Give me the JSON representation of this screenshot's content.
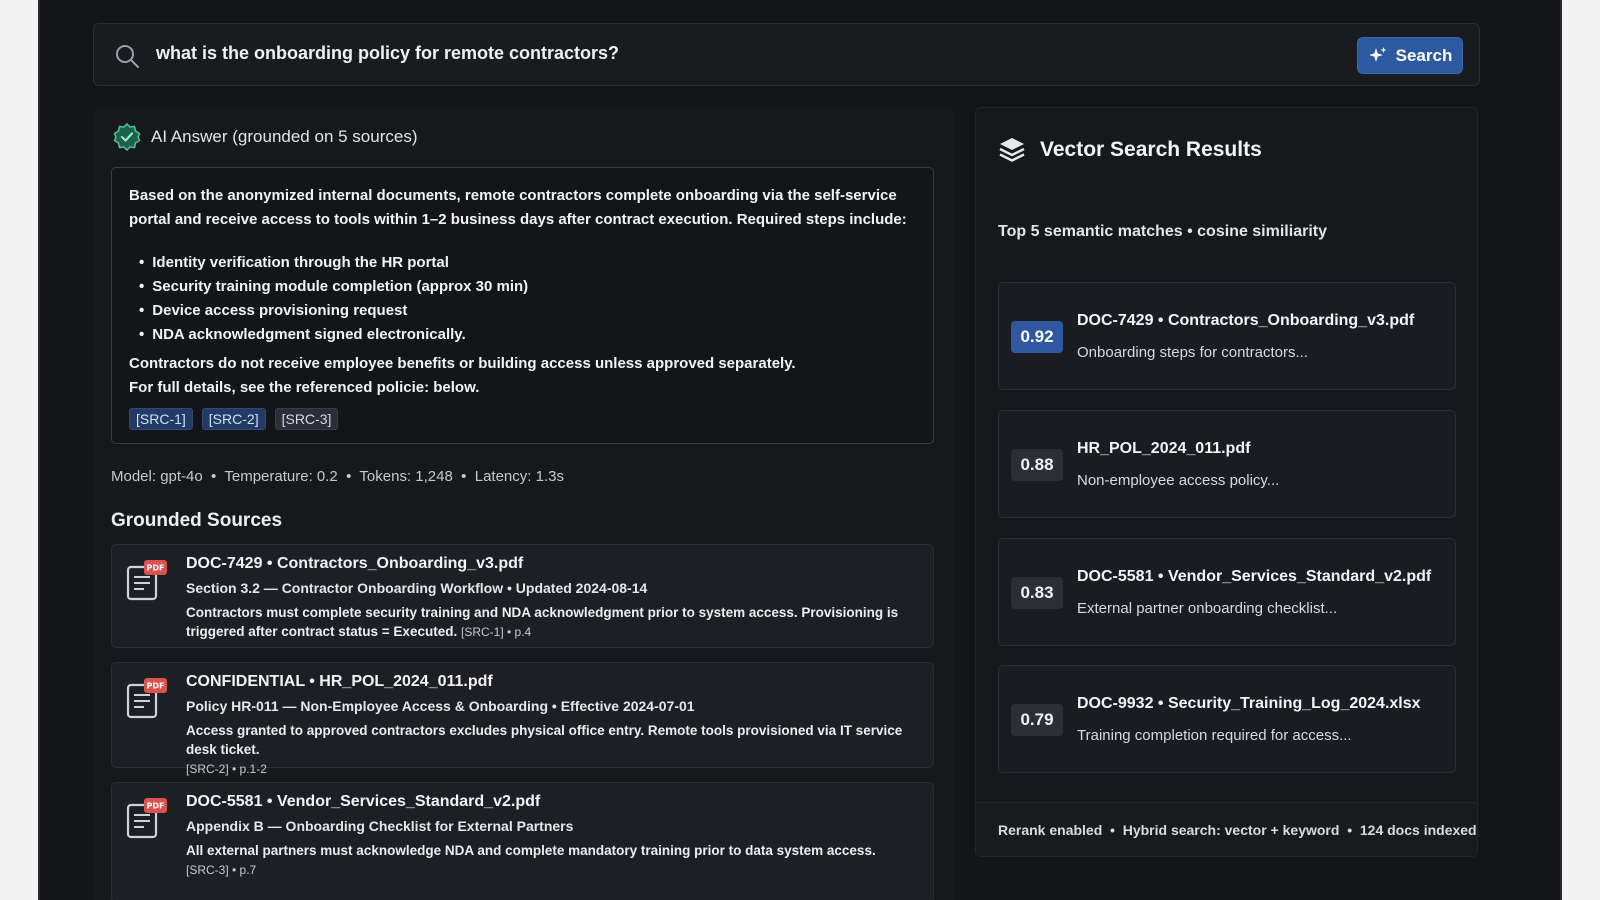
{
  "search": {
    "query": "what is the onboarding policy for remote contractors?",
    "button_label": "Search"
  },
  "answer": {
    "header": "AI Answer (grounded on 5 sources)",
    "intro": "Based on the anonymized internal documents, remote contractors complete onboarding via the self-service portal and receive access to tools within 1–2 business days after contract execution. Required steps include:",
    "steps": [
      "Identity verification through the HR portal",
      "Security training module completion (approx 30 min)",
      "Device access provisioning request",
      "NDA acknowledgment signed electronically."
    ],
    "note1": "Contractors do not receive employee benefits or building access unless approved separately.",
    "note2": "For full details, see the referenced policie: below.",
    "src_tags": [
      "[SRC-1]",
      "[SRC-2]",
      "[SRC-3]"
    ]
  },
  "meta_line": "Model: gpt-4o  •  Temperature: 0.2  •  Tokens: 1,248  •  Latency: 1.3s",
  "grounded_sources": {
    "title": "Grounded Sources",
    "items": [
      {
        "badge": "PDF",
        "title": "DOC-7429 • Contractors_Onboarding_v3.pdf",
        "subtitle": "Section 3.2 — Contractor Onboarding Workflow • Updated 2024-08-14",
        "body": "Contractors must complete security training and NDA acknowledgment prior to system access. Provisioning is triggered after contract status = Executed.",
        "ref": "[SRC-1] • p.4"
      },
      {
        "badge": "PDF",
        "title": "CONFIDENTIAL • HR_POL_2024_011.pdf",
        "subtitle": "Policy HR-011 — Non-Employee Access & Onboarding • Effective 2024-07-01",
        "body": "Access granted to approved contractors excludes physical office entry. Remote tools provisioned via IT service desk ticket.",
        "ref": "[SRC-2] • p.1-2"
      },
      {
        "badge": "PDF",
        "title": "DOC-5581 • Vendor_Services_Standard_v2.pdf",
        "subtitle": "Appendix B — Onboarding Checklist for External Partners",
        "body": "All external partners must acknowledge NDA and complete mandatory training prior to data system access.",
        "ref": "[SRC-3] • p.7"
      }
    ]
  },
  "vector": {
    "title": "Vector Search Results",
    "subtitle": "Top 5 semantic matches • cosine similiarity",
    "results": [
      {
        "score": "0.92",
        "title": "DOC-7429 • Contractors_Onboarding_v3.pdf",
        "desc": "Onboarding steps for contractors..."
      },
      {
        "score": "0.88",
        "title": "HR_POL_2024_011.pdf",
        "desc": "Non-employee access policy..."
      },
      {
        "score": "0.83",
        "title": "DOC-5581 • Vendor_Services_Standard_v2.pdf",
        "desc": "External partner onboarding checklist..."
      },
      {
        "score": "0.79",
        "title": "DOC-9932 • Security_Training_Log_2024.xlsx",
        "desc": "Training completion required for access..."
      }
    ],
    "footer": "Rerank enabled  •  Hybrid search: vector + keyword  •  124 docs indexed"
  },
  "colors": {
    "accent": "#2c59a0",
    "pdf_badge": "#d9534f",
    "verified": "#4fc39a"
  }
}
